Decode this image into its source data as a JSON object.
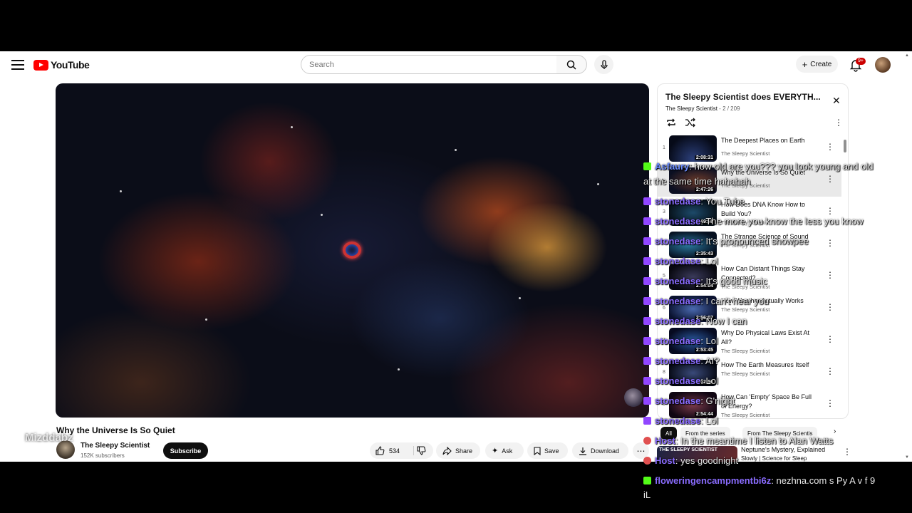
{
  "header": {
    "logo_text": "YouTube",
    "search_placeholder": "Search",
    "create_label": "Create",
    "notifications_badge": "9+"
  },
  "video": {
    "title": "Why the Universe Is So Quiet",
    "channel_name": "The Sleepy Scientist",
    "subscribers": "152K subscribers",
    "subscribe_label": "Subscribe",
    "like_count": "534",
    "share_label": "Share",
    "ask_label": "Ask",
    "save_label": "Save",
    "download_label": "Download"
  },
  "playlist": {
    "title": "The Sleepy Scientist does EVERYTH...",
    "owner": "The Sleepy Scientist",
    "position": "2 / 209",
    "items": [
      {
        "index": "1",
        "title": "The Deepest Places on Earth",
        "channel": "The Sleepy Scientist",
        "duration": "2:08:31",
        "thumb_caption": "DEEPEST PLACE ON EARTH"
      },
      {
        "index": "",
        "title": "Why the Universe Is So Quiet",
        "channel": "The Sleepy Scientist",
        "duration": "2:47:26",
        "thumb_caption": "QUIET"
      },
      {
        "index": "3",
        "title": "How Does DNA Know How to Build You?",
        "channel": "The Sleepy Scientist",
        "duration": "2:49:58",
        "thumb_caption": "YOU"
      },
      {
        "index": "4",
        "title": "The Strange Science of Sound",
        "channel": "The Sleepy Scientist",
        "duration": "2:35:43",
        "thumb_caption": "SCIENCE OF SOUND"
      },
      {
        "index": "5",
        "title": "How Can Distant Things Stay Connected?",
        "channel": "The Sleepy Scientist",
        "duration": "2:54:04",
        "thumb_caption": ""
      },
      {
        "index": "6",
        "title": "How Weather Actually Works",
        "channel": "The Sleepy Scientist",
        "duration": "2:56:07",
        "thumb_caption": "THE SLEEPY"
      },
      {
        "index": "7",
        "title": "Why Do Physical Laws Exist At All?",
        "channel": "The Sleepy Scientist",
        "duration": "2:53:45",
        "thumb_caption": "PHYSICAL LAWS"
      },
      {
        "index": "8",
        "title": "How The Earth Measures Itself",
        "channel": "The Sleepy Scientist",
        "duration": "3:02:56",
        "thumb_caption": ""
      },
      {
        "index": "9",
        "title": "How Can 'Empty' Space Be Full of Energy?",
        "channel": "The Sleepy Scientist",
        "duration": "2:54:44",
        "thumb_caption": "THE SLEEPY SCIENTIST"
      }
    ]
  },
  "chips": [
    "All",
    "From the series",
    "From The Sleepy Scientis"
  ],
  "recommended": {
    "thumb_caption": "THE SLEEPY SCIENTIST",
    "title": "Neptune's Mystery, Explained",
    "subtitle": "Slowly | Science for Sleep"
  },
  "chat": [
    {
      "platform": "kick",
      "name": "Asfaury",
      "text": "how old are you??? you look young and old",
      "name_color": "#6a8cff"
    },
    {
      "platform": "",
      "name": "",
      "text": "at the same time hahahah",
      "name_color": ""
    },
    {
      "platform": "twitch",
      "name": "stonedase",
      "text": "You Tube",
      "name_color": "#8a6cff"
    },
    {
      "platform": "twitch",
      "name": "stonedase",
      "text": "The more you know the less you know",
      "name_color": "#8a6cff"
    },
    {
      "platform": "twitch",
      "name": "stonedase",
      "text": "It's pronounced showpee",
      "name_color": "#8a6cff"
    },
    {
      "platform": "twitch",
      "name": "stonedase",
      "text": "Lol",
      "name_color": "#8a6cff"
    },
    {
      "platform": "twitch",
      "name": "stonedase",
      "text": "It's good music",
      "name_color": "#8a6cff"
    },
    {
      "platform": "twitch",
      "name": "stonedase",
      "text": "I can't hear you",
      "name_color": "#8a6cff"
    },
    {
      "platform": "twitch",
      "name": "stonedase",
      "text": "Now I can",
      "name_color": "#8a6cff"
    },
    {
      "platform": "twitch",
      "name": "stonedase",
      "text": "Lol",
      "name_color": "#8a6cff"
    },
    {
      "platform": "twitch",
      "name": "stonedase",
      "text": "AI?",
      "name_color": "#8a6cff"
    },
    {
      "platform": "twitch",
      "name": "stonedase",
      "text": "Lol",
      "name_color": "#8a6cff"
    },
    {
      "platform": "twitch",
      "name": "stonedase",
      "text": "G'night",
      "name_color": "#8a6cff"
    },
    {
      "platform": "twitch",
      "name": "stonedase",
      "text": "Lol",
      "name_color": "#8a6cff"
    },
    {
      "platform": "host",
      "name": "Host",
      "text": "In the meantime I listen to Alan Watts",
      "name_color": "#8a6cff"
    },
    {
      "platform": "host",
      "name": "Host",
      "text": "yes goodnight",
      "name_color": "#8a6cff"
    },
    {
      "platform": "kick",
      "name": "floweringencampmentbi6z",
      "text": "nezhna.com s Py A v f 9",
      "name_color": "#8a6cff"
    },
    {
      "platform": "",
      "name": "",
      "text": "iL",
      "name_color": ""
    }
  ],
  "watermark": "Mizddabz"
}
